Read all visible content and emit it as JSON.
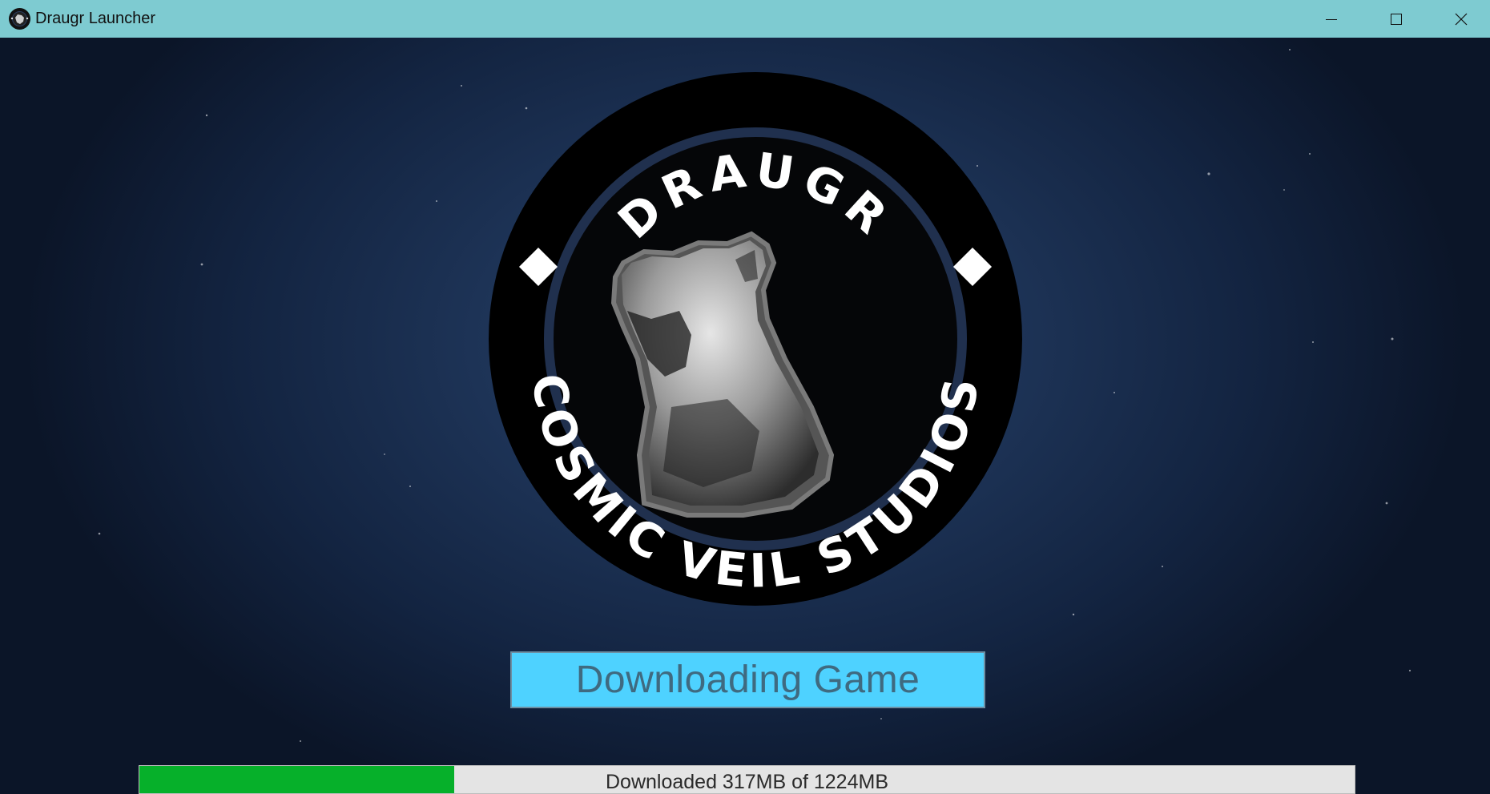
{
  "window": {
    "title": "Draugr Launcher",
    "controls": {
      "minimize_icon": "minimize-icon",
      "maximize_icon": "maximize-icon",
      "close_icon": "close-icon"
    }
  },
  "logo": {
    "top_text": "DRAUGR",
    "bottom_text": "COSMIC VEIL STUDIOS"
  },
  "main": {
    "action_button_label": "Downloading Game"
  },
  "progress": {
    "text": "Downloaded 317MB of 1224MB",
    "downloaded_mb": 317,
    "total_mb": 1224,
    "fill_color": "#06b02a"
  },
  "colors": {
    "titlebar": "#7ecbd1",
    "button": "#4ed2ff",
    "background": "#1d3356"
  }
}
